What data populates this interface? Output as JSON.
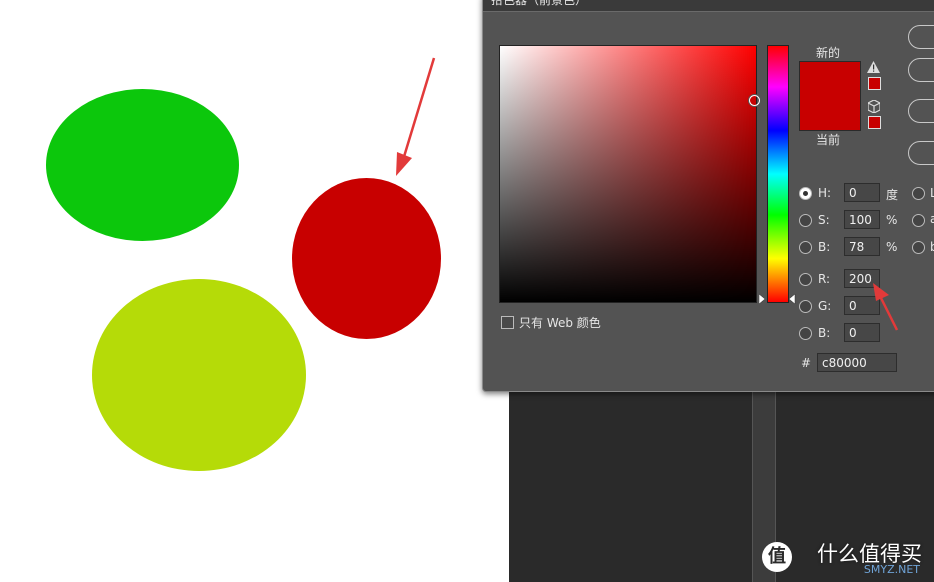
{
  "canvas": {
    "shapes": [
      {
        "name": "green-ellipse",
        "color": "#0cc70c"
      },
      {
        "name": "lime-ellipse",
        "color": "#b5db08"
      },
      {
        "name": "red-ellipse",
        "color": "#c80000"
      }
    ],
    "arrow_color": "#e23a3a"
  },
  "dialog": {
    "title": "拾色器（前景色）",
    "new_label": "新的",
    "current_label": "当前",
    "new_color": "#c80000",
    "current_color": "#c80000",
    "web_only_label": "只有 Web 颜色",
    "hsb": {
      "h": {
        "label": "H:",
        "value": "0",
        "unit": "度"
      },
      "s": {
        "label": "S:",
        "value": "100",
        "unit": "%"
      },
      "b": {
        "label": "B:",
        "value": "78",
        "unit": "%"
      }
    },
    "rgb": {
      "r": {
        "label": "R:",
        "value": "200"
      },
      "g": {
        "label": "G:",
        "value": "0"
      },
      "b": {
        "label": "B:",
        "value": "0"
      }
    },
    "lab_partial": {
      "l": {
        "label": "L"
      },
      "a": {
        "label": "a"
      },
      "b": {
        "label": "b"
      }
    },
    "hex": {
      "label": "#",
      "value": "c80000"
    },
    "selected_mode": "H"
  },
  "watermark": {
    "logo": "值",
    "text": "什么值得买",
    "subtext": "SMYZ.NET"
  }
}
